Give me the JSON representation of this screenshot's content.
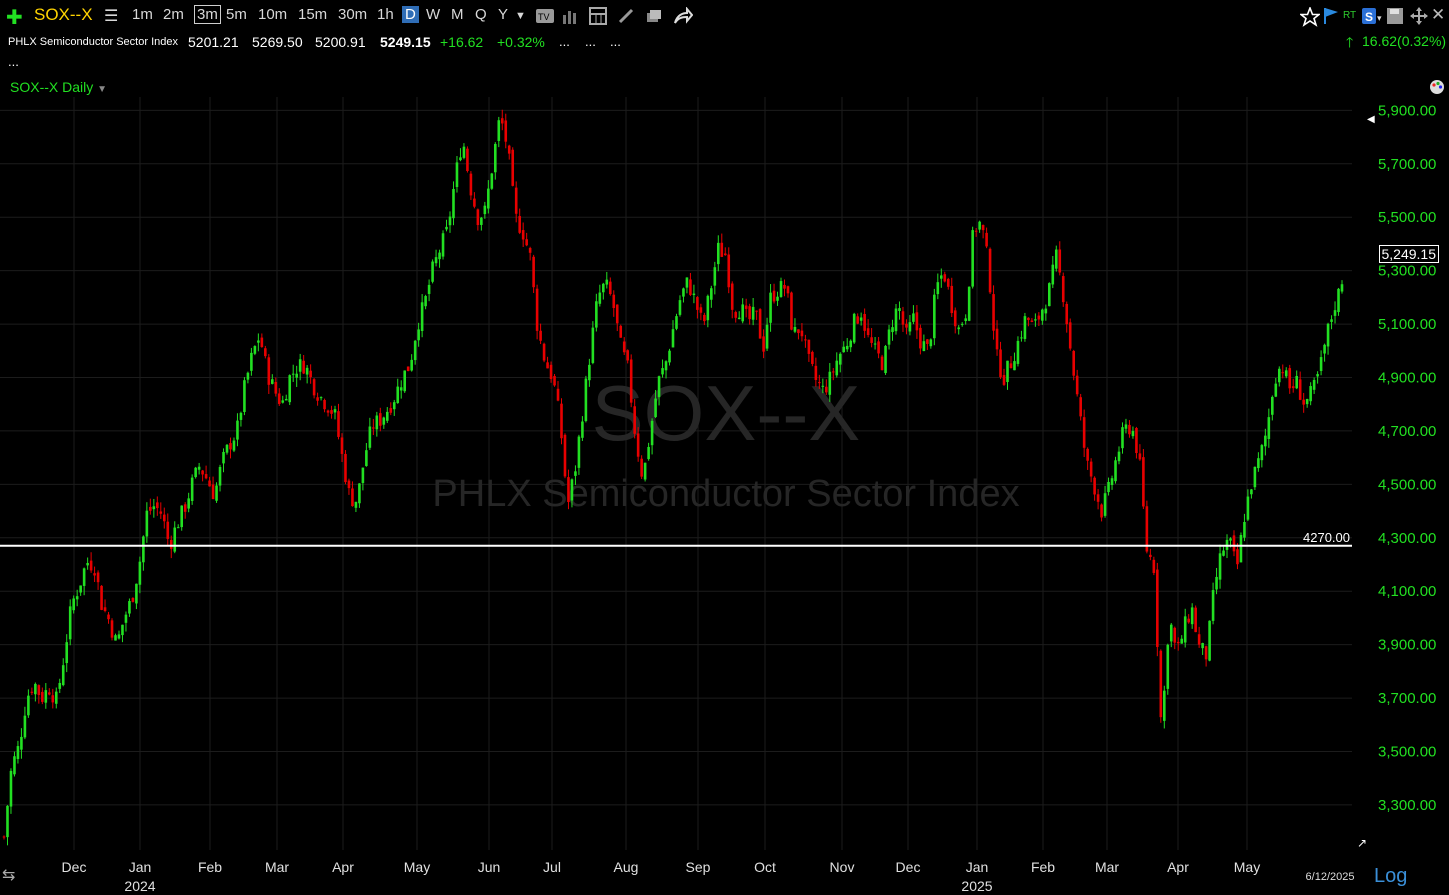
{
  "toolbar": {
    "symbol": "SOX--X",
    "intervals": [
      "1m",
      "2m",
      "3m",
      "5m",
      "10m",
      "15m",
      "30m",
      "1h",
      "D",
      "W",
      "M",
      "Q",
      "Y"
    ],
    "active_interval": "3m",
    "highlighted_period": "D"
  },
  "quote": {
    "name": "PHLX Semiconductor Sector Index",
    "open": "5201.21",
    "high": "5269.50",
    "low": "5200.91",
    "last": "5249.15",
    "change": "+16.62",
    "change_pct": "+0.32%",
    "dots1": "...",
    "dots2": "...",
    "dots3": "...",
    "right_change": "16.62(0.32%)",
    "more": "..."
  },
  "chart_label": "SOX--X Daily",
  "watermark": {
    "symbol": "SOX--X",
    "name": "PHLX Semiconductor Sector Index"
  },
  "last_price_tag": "5,249.15",
  "hline_label": "4270.00",
  "date_stamp": "6/12/2025",
  "log_label": "Log",
  "colors": {
    "up": "#22e022",
    "down": "#e80000",
    "axis": "#22e022",
    "grid": "#1c1c1c"
  },
  "chart_data": {
    "type": "candlestick",
    "title": "SOX--X Daily",
    "ylim": [
      3150,
      5950
    ],
    "y_ticks": [
      3300,
      3500,
      3700,
      3900,
      4100,
      4300,
      4500,
      4700,
      4900,
      5100,
      5300,
      5500,
      5700,
      5900
    ],
    "y_tick_labels": [
      "3,300.00",
      "3,500.00",
      "3,700.00",
      "3,900.00",
      "4,100.00",
      "4,300.00",
      "4,500.00",
      "4,700.00",
      "4,900.00",
      "5,100.00",
      "5,300.00",
      "5,500.00",
      "5,700.00",
      "5,900.00"
    ],
    "x_labels": [
      "Dec",
      "Jan",
      "Feb",
      "Mar",
      "Apr",
      "May",
      "Jun",
      "Jul",
      "Aug",
      "Sep",
      "Oct",
      "Nov",
      "Dec",
      "Jan",
      "Feb",
      "Mar",
      "Apr",
      "May"
    ],
    "year_labels": [
      "2024",
      "2025"
    ],
    "horizontal_line": 4270,
    "last_close": 5249.15,
    "close_path": [
      3180,
      3440,
      3520,
      3700,
      3760,
      3700,
      3740,
      3690,
      3860,
      4050,
      4120,
      4210,
      4200,
      4050,
      3990,
      3900,
      4000,
      4070,
      4200,
      4390,
      4420,
      4390,
      4270,
      4350,
      4410,
      4500,
      4570,
      4520,
      4460,
      4580,
      4650,
      4700,
      4860,
      4980,
      5060,
      4920,
      4850,
      4800,
      4900,
      4940,
      4950,
      4880,
      4830,
      4800,
      4760,
      4600,
      4450,
      4440,
      4610,
      4720,
      4740,
      4780,
      4830,
      4900,
      4950,
      5100,
      5180,
      5300,
      5380,
      5450,
      5640,
      5800,
      5620,
      5500,
      5520,
      5700,
      5880,
      5760,
      5500,
      5450,
      5350,
      5080,
      4960,
      4900,
      4730,
      4420,
      4560,
      4780,
      5000,
      5200,
      5250,
      5180,
      5020,
      4930,
      4680,
      4520,
      4700,
      4880,
      4950,
      5080,
      5200,
      5260,
      5180,
      5090,
      5230,
      5380,
      5360,
      5150,
      5160,
      5110,
      5140,
      5010,
      5200,
      5230,
      5240,
      5060,
      5090,
      4960,
      4890,
      4850,
      4900,
      4980,
      5020,
      5100,
      5150,
      5040,
      4990,
      4950,
      5100,
      5170,
      5050,
      5120,
      5030,
      5000,
      5230,
      5300,
      5180,
      5080,
      5150,
      5460,
      5480,
      5310,
      4980,
      4900,
      4960,
      5040,
      5130,
      5080,
      5150,
      5220,
      5350,
      5200,
      4980,
      4780,
      4580,
      4500,
      4400,
      4480,
      4600,
      4700,
      4720,
      4600,
      4260,
      4190,
      3560,
      4010,
      3860,
      3960,
      4040,
      3890,
      3860,
      4110,
      4250,
      4290,
      4180,
      4380,
      4510,
      4590,
      4700,
      4900,
      4950,
      4860,
      4880,
      4800,
      4840,
      4920,
      5060,
      5170,
      5249.15
    ]
  }
}
